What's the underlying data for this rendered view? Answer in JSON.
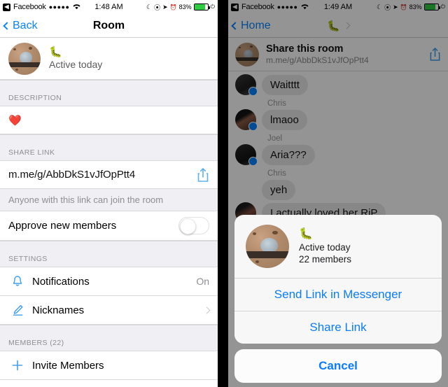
{
  "left": {
    "statusbar": {
      "back_chip": "◀",
      "carrier": "Facebook",
      "signal_dots": "●●●●●",
      "wifi_icon": "wifi-icon",
      "time": "1:48 AM",
      "moon_icon": "☾",
      "lock_icon": "⦿",
      "location_icon": "➤",
      "alarm_icon": "⏰",
      "battery_percent": "83%"
    },
    "nav": {
      "back_label": "Back",
      "title": "Room"
    },
    "room": {
      "name_emoji": "🐛",
      "status": "Active today"
    },
    "sections": {
      "description_header": "DESCRIPTION",
      "description_value": "❤️",
      "share_link_header": "SHARE LINK",
      "share_link_value": "m.me/g/AbbDkS1vJfOpPtt4",
      "share_link_hint": "Anyone with this link can join the room",
      "approve_label": "Approve new members",
      "approve_state": "off",
      "settings_header": "SETTINGS",
      "notifications_label": "Notifications",
      "notifications_value": "On",
      "nicknames_label": "Nicknames",
      "members_header": "MEMBERS (22)",
      "invite_label": "Invite Members"
    }
  },
  "right": {
    "statusbar": {
      "back_chip": "◀",
      "carrier": "Facebook",
      "signal_dots": "●●●●●",
      "time": "1:49 AM",
      "battery_percent": "83%"
    },
    "nav": {
      "back_label": "Home",
      "title_emoji": "🐛"
    },
    "banner": {
      "title": "Share this room",
      "subtitle": "m.me/g/AbbDkS1vJfOpPtt4"
    },
    "messages": [
      {
        "sender": "",
        "text": "Waitttt"
      },
      {
        "sender": "Chris",
        "text": "lmaoo"
      },
      {
        "sender": "Joel",
        "text": "Aria???"
      },
      {
        "sender": "Chris",
        "text": "yeh"
      },
      {
        "sender": "",
        "text": "I actually loved her RiP"
      }
    ],
    "sheet": {
      "emoji": "🐛",
      "active": "Active today",
      "members": "22 members",
      "send_link": "Send Link in Messenger",
      "share_link": "Share Link",
      "cancel": "Cancel"
    }
  },
  "colors": {
    "accent_blue": "#0a7cff",
    "nav_blue": "#0a84ff",
    "group_bg": "#efeff4",
    "battery_green": "#2ecc40"
  }
}
